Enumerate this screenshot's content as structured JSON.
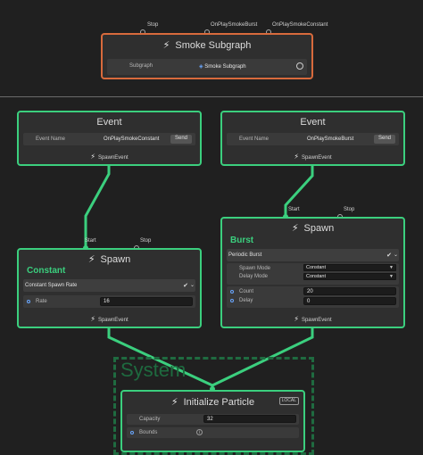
{
  "subgraph": {
    "ports": [
      "Stop",
      "OnPlaySmokeBurst",
      "OnPlaySmokeConstant"
    ],
    "title": "Smoke Subgraph",
    "field_label": "Subgraph",
    "field_value": "Smoke Subgraph"
  },
  "event_left": {
    "title": "Event",
    "field_label": "Event Name",
    "field_value": "OnPlaySmokeConstant",
    "button": "Send",
    "output": "SpawnEvent"
  },
  "event_right": {
    "title": "Event",
    "field_label": "Event Name",
    "field_value": "OnPlaySmokeBurst",
    "button": "Send",
    "output": "SpawnEvent"
  },
  "spawn_left": {
    "port_start": "Start",
    "port_stop": "Stop",
    "title": "Spawn",
    "heading": "Constant",
    "block_title": "Constant Spawn Rate",
    "rate_label": "Rate",
    "rate_value": "16",
    "output": "SpawnEvent"
  },
  "spawn_right": {
    "port_start": "Start",
    "port_stop": "Stop",
    "title": "Spawn",
    "heading": "Burst",
    "block_title": "Periodic Burst",
    "spawn_mode_label": "Spawn Mode",
    "spawn_mode_value": "Constant",
    "delay_mode_label": "Delay Mode",
    "delay_mode_value": "Constant",
    "count_label": "Count",
    "count_value": "20",
    "delay_label": "Delay",
    "delay_value": "0",
    "output": "SpawnEvent"
  },
  "system": {
    "label": "System"
  },
  "init": {
    "title": "Initialize Particle",
    "badge": "LOCAL",
    "capacity_label": "Capacity",
    "capacity_value": "32",
    "bounds_label": "Bounds"
  },
  "colors": {
    "accent": "#3bcf7e",
    "subgraph_border": "#d86a3c",
    "background": "#202020",
    "node_bg": "#2f2f2f"
  },
  "icons": [
    "lightning-icon",
    "subgraph-asset-icon",
    "object-picker-icon",
    "checkbox-icon",
    "collapse-chevron-icon",
    "info-icon"
  ]
}
